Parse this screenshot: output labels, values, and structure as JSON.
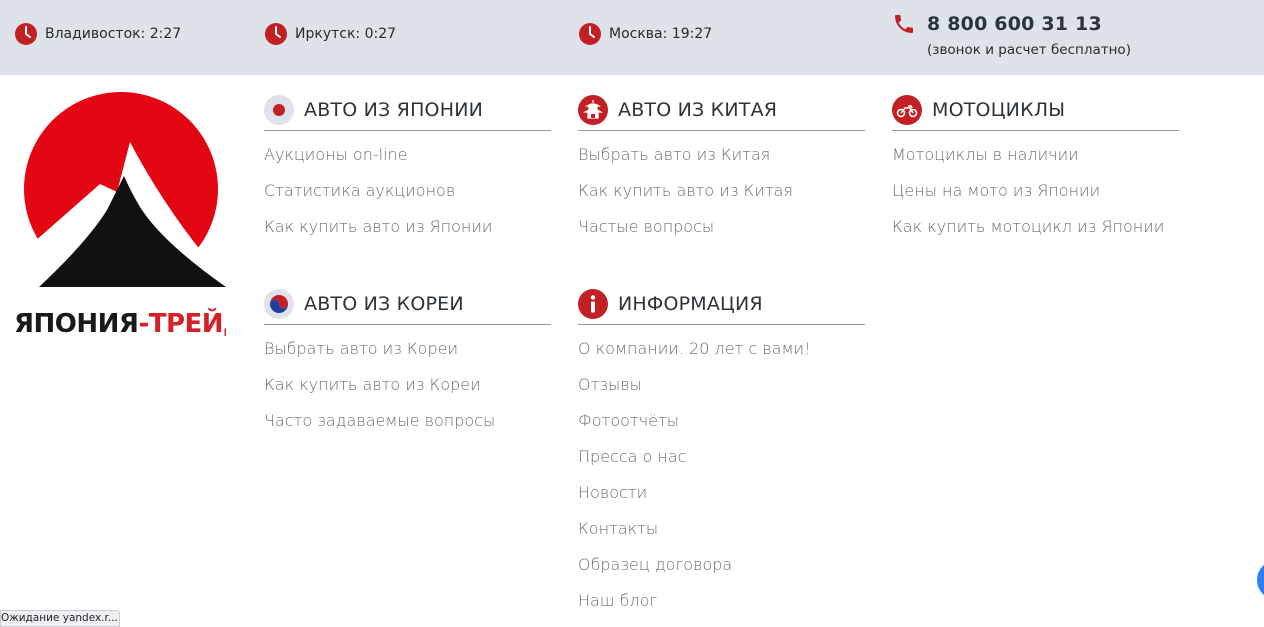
{
  "header": {
    "clocks": [
      {
        "label": "Владивосток: 2:27"
      },
      {
        "label": "Иркутск: 0:27"
      },
      {
        "label": "Москва: 19:27"
      }
    ],
    "phone": "8 800 600 31 13",
    "phone_note": "(звонок и расчет бесплатно)"
  },
  "logo": {
    "text_black": "ЯПОНИЯ",
    "text_red": "-ТРЕЙД"
  },
  "menu": {
    "japan": {
      "title": "АВТО ИЗ ЯПОНИИ",
      "items": [
        "Аукционы on-line",
        "Статистика аукционов",
        "Как купить авто из Японии"
      ]
    },
    "china": {
      "title": "АВТО ИЗ КИТАЯ",
      "items": [
        "Выбрать авто из Китая",
        "Как купить авто из Китая",
        "Частые вопросы"
      ]
    },
    "moto": {
      "title": "МОТОЦИКЛЫ",
      "items": [
        "Мотоциклы в наличии",
        "Цены на мото из Японии",
        "Как купить мотоцикл из Японии"
      ]
    },
    "korea": {
      "title": "АВТО ИЗ КОРЕИ",
      "items": [
        "Выбрать авто из Кореи",
        "Как купить авто из Кореи",
        "Часто задаваемые вопросы"
      ]
    },
    "info": {
      "title": "ИНФОРМАЦИЯ",
      "items": [
        "О компании. 20 лет с вами!",
        "Отзывы",
        "Фотоотчёты",
        "Пресса о нас",
        "Новости",
        "Контакты",
        "Образец договора",
        "Наш блог"
      ]
    }
  },
  "status_bar": "Ожидание yandex.r...",
  "colors": {
    "accent": "#d42127",
    "topbar": "#dde3e9",
    "link": "#6d6d6d"
  }
}
